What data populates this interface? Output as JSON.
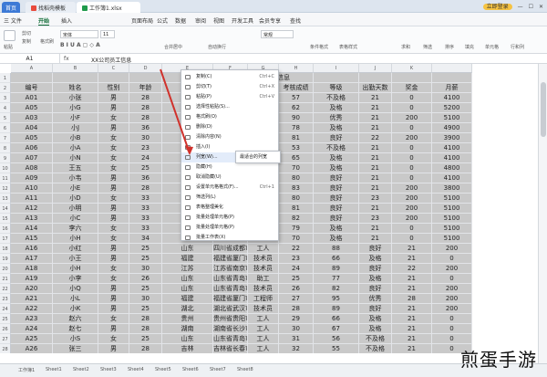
{
  "titlebar": {
    "home": "首页",
    "tab1": "找稻壳模板",
    "tab2": "工作簿1.xlsx",
    "login": "立即登录"
  },
  "menubar": {
    "items": [
      "三 文件",
      "开始",
      "插入",
      "页面布局",
      "公式",
      "数据",
      "审阅",
      "视图",
      "开发工具",
      "会员专享",
      "查找"
    ],
    "active": "开始"
  },
  "ribbon": {
    "paste": "粘贴",
    "cut": "剪切",
    "copy": "复制",
    "format_painter": "格式刷",
    "font": "宋体",
    "size": "11",
    "merge": "合并居中",
    "wrap": "自动换行",
    "general": "常规",
    "cond_format": "条件格式",
    "table_style": "表格样式",
    "sum": "求和",
    "filter": "筛选",
    "sort": "排序",
    "fill": "填充",
    "cell": "单元格",
    "row_col": "行和列",
    "worksheet": "工作表",
    "freeze": "冻结窗格"
  },
  "formula": {
    "namebox": "A1",
    "fx": "fx",
    "value": "XX公司员工信息"
  },
  "header_merged": "工信息",
  "columns": [
    "A",
    "B",
    "C",
    "D",
    "E",
    "F",
    "G",
    "H",
    "I",
    "J",
    "K"
  ],
  "headers": [
    "编号",
    "姓名",
    "性别",
    "年龄",
    "籍",
    "",
    "工号",
    "考核成绩",
    "等级",
    "出勤天数",
    "奖金",
    "月薪"
  ],
  "rows": [
    [
      "A01",
      "小张",
      "男",
      "28",
      "四川",
      "师",
      "5",
      "57",
      "不及格",
      "21",
      "0",
      "4100"
    ],
    [
      "A05",
      "小G",
      "男",
      "28",
      "湖南",
      "师",
      "8",
      "62",
      "及格",
      "21",
      "0",
      "5200"
    ],
    [
      "A03",
      "小F",
      "女",
      "28",
      "辽宁",
      "师",
      "9",
      "90",
      "优秀",
      "21",
      "200",
      "5100"
    ],
    [
      "A04",
      "小J",
      "男",
      "36",
      "江苏",
      "工",
      "10",
      "78",
      "及格",
      "21",
      "0",
      "4900"
    ],
    [
      "A05",
      "小B",
      "女",
      "30",
      "四川",
      "工",
      "11",
      "81",
      "良好",
      "22",
      "200",
      "3900"
    ],
    [
      "A06",
      "小A",
      "女",
      "23",
      "湖北",
      "工",
      "12",
      "53",
      "不及格",
      "21",
      "0",
      "4100"
    ],
    [
      "A07",
      "小N",
      "女",
      "24",
      "吉林",
      "员",
      "13",
      "65",
      "及格",
      "21",
      "0",
      "4100"
    ],
    [
      "A08",
      "王五",
      "女",
      "25",
      "吉林",
      "员",
      "14",
      "70",
      "及格",
      "21",
      "0",
      "4800"
    ],
    [
      "A09",
      "小韦",
      "男",
      "36",
      "吉林",
      "员",
      "15",
      "80",
      "良好",
      "21",
      "0",
      "4100"
    ],
    [
      "A10",
      "小E",
      "男",
      "28",
      "吉林",
      "员",
      "16",
      "83",
      "良好",
      "21",
      "200",
      "3800"
    ],
    [
      "A11",
      "小D",
      "女",
      "33",
      "湖北",
      "员",
      "17",
      "80",
      "良好",
      "23",
      "200",
      "5100"
    ],
    [
      "A12",
      "小明",
      "男",
      "33",
      "湖北",
      "员",
      "18",
      "81",
      "良好",
      "21",
      "200",
      "5100"
    ],
    [
      "A13",
      "小C",
      "男",
      "33",
      "湖南",
      "员",
      "19",
      "82",
      "良好",
      "23",
      "200",
      "5100"
    ],
    [
      "A14",
      "李六",
      "女",
      "33",
      "吉林",
      "工",
      "20",
      "79",
      "及格",
      "21",
      "0",
      "5100"
    ],
    [
      "A15",
      "小H",
      "女",
      "34",
      "江苏",
      "工",
      "21",
      "70",
      "及格",
      "21",
      "0",
      "5100"
    ],
    [
      "A16",
      "小红",
      "男",
      "25",
      "山东",
      "四川省成都市",
      "工人",
      "22",
      "88",
      "良好",
      "21",
      "200"
    ],
    [
      "A17",
      "小王",
      "男",
      "25",
      "福建",
      "福建省厦门市",
      "技术员",
      "23",
      "66",
      "及格",
      "21",
      "0"
    ],
    [
      "A18",
      "小H",
      "女",
      "30",
      "江苏",
      "江苏省南京市",
      "技术员",
      "24",
      "89",
      "良好",
      "22",
      "200"
    ],
    [
      "A19",
      "小李",
      "女",
      "26",
      "山东",
      "山东省青岛市",
      "助工",
      "25",
      "77",
      "及格",
      "21",
      "0"
    ],
    [
      "A20",
      "小Q",
      "男",
      "25",
      "山东",
      "山东省青岛市",
      "技术员",
      "26",
      "82",
      "良好",
      "21",
      "200"
    ],
    [
      "A21",
      "小L",
      "男",
      "30",
      "福建",
      "福建省厦门市",
      "工程师",
      "27",
      "95",
      "优秀",
      "28",
      "200"
    ],
    [
      "A22",
      "小K",
      "男",
      "25",
      "湖北",
      "湖北省武汉市",
      "技术员",
      "28",
      "89",
      "良好",
      "21",
      "200"
    ],
    [
      "A23",
      "赵六",
      "女",
      "28",
      "贵州",
      "贵州省贵阳市",
      "工人",
      "29",
      "66",
      "及格",
      "21",
      "0"
    ],
    [
      "A24",
      "赵七",
      "男",
      "28",
      "湖南",
      "湖南省长沙市",
      "工人",
      "30",
      "67",
      "及格",
      "21",
      "0"
    ],
    [
      "A25",
      "小S",
      "女",
      "25",
      "山东",
      "山东省青岛市",
      "工人",
      "31",
      "56",
      "不及格",
      "21",
      "0"
    ],
    [
      "A26",
      "张三",
      "男",
      "28",
      "吉林",
      "吉林省长春市",
      "工人",
      "32",
      "55",
      "不及格",
      "21",
      "0"
    ]
  ],
  "context_menu": [
    {
      "label": "复制(C)",
      "shortcut": "Ctrl+C"
    },
    {
      "label": "剪切(T)",
      "shortcut": "Ctrl+X"
    },
    {
      "label": "粘贴(P)",
      "shortcut": "Ctrl+V"
    },
    {
      "label": "选择性粘贴(S)...",
      "shortcut": ""
    },
    {
      "label": "格式刷(O)",
      "shortcut": ""
    },
    {
      "label": "删除(D)",
      "shortcut": ""
    },
    {
      "label": "清除内容(N)",
      "shortcut": ""
    },
    {
      "label": "插入(I)",
      "shortcut": ""
    },
    {
      "label": "列宽(W)...",
      "shortcut": ""
    },
    {
      "label": "隐藏(H)",
      "shortcut": ""
    },
    {
      "label": "取消隐藏(U)",
      "shortcut": ""
    },
    {
      "label": "设置单元格格式(F)...",
      "shortcut": "Ctrl+1"
    },
    {
      "label": "筛选列(L)",
      "shortcut": ""
    },
    {
      "label": "表格整理美化",
      "shortcut": ""
    },
    {
      "label": "批量处理单元格(P)",
      "shortcut": ""
    },
    {
      "label": "批量处理单元格(P)",
      "shortcut": ""
    },
    {
      "label": "批量工作表(X)",
      "shortcut": ""
    }
  ],
  "submenu": "最适合的列宽",
  "sheets": [
    "工作簿1",
    "Sheet1",
    "Sheet2",
    "Sheet3",
    "Sheet4",
    "Sheet5",
    "Sheet6",
    "Sheet7",
    "Sheet8"
  ],
  "watermark": "煎蛋手游"
}
